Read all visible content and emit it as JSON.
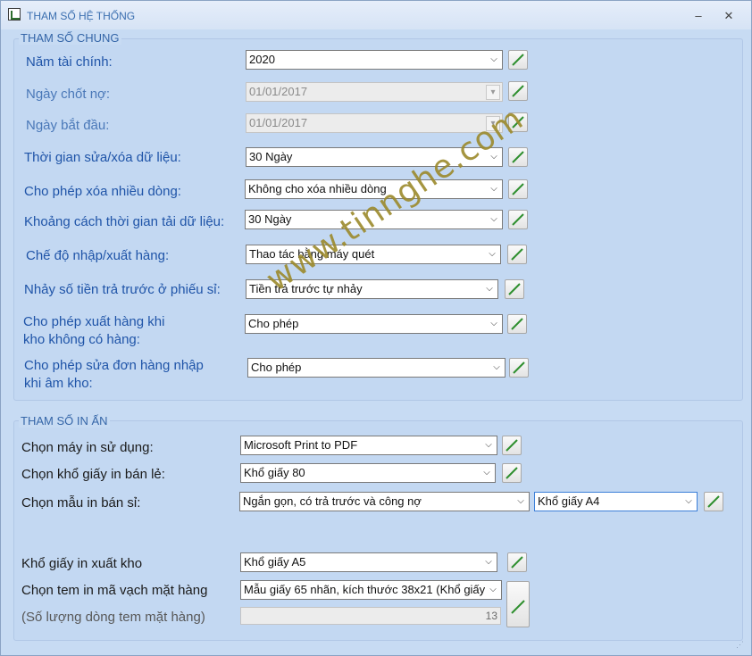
{
  "window": {
    "title": "THAM SỐ HỆ THỐNG",
    "minimize": "–",
    "close": "✕"
  },
  "general": {
    "title": "THAM SỐ CHUNG",
    "rows": [
      {
        "label": "Năm tài chính:",
        "value": "2020"
      },
      {
        "label": "Ngày chốt nợ:",
        "value": "01/01/2017"
      },
      {
        "label": "Ngày bắt đầu:",
        "value": "01/01/2017"
      },
      {
        "label": "Thời gian sửa/xóa dữ liệu:",
        "value": "30 Ngày"
      },
      {
        "label": "Cho phép xóa nhiều dòng:",
        "value": "Không cho xóa nhiều dòng"
      },
      {
        "label": "Khoảng cách thời gian tải dữ liệu:",
        "value": "30 Ngày"
      },
      {
        "label": "Chế độ nhập/xuất hàng:",
        "value": "Thao tác bằng máy quét"
      },
      {
        "label": "Nhảy số tiền trả trước ở phiếu sỉ:",
        "value": "Tiền trả trước tự nhảy"
      },
      {
        "label": "Cho phép xuất hàng khi",
        "label2": "kho không có hàng:",
        "value": "Cho phép"
      },
      {
        "label": "Cho phép sửa đơn hàng nhập",
        "label2": "khi âm kho:",
        "value": "Cho phép"
      }
    ]
  },
  "print": {
    "title": "THAM SỐ IN ẤN",
    "printer": {
      "label": "Chọn máy in sử dụng:",
      "value": "Microsoft Print to PDF"
    },
    "retail_paper": {
      "label": "Chọn khổ giấy in bán lẻ:",
      "value": "Khổ giấy 80"
    },
    "wholesale_template": {
      "label": "Chọn mẫu in bán sỉ:",
      "value": "Ngắn gọn, có trả trước và công nợ",
      "paper": "Khổ giấy A4"
    },
    "warehouse_paper": {
      "label": "Khổ giấy in xuất kho",
      "value": "Khổ giấy A5"
    },
    "barcode_template": {
      "label": "Chọn tem in mã vạch mặt hàng",
      "value": "Mẫu giấy 65 nhãn, kích thước 38x21 (Khổ giấy"
    },
    "label_rows": {
      "label": "(Số lượng dòng tem mặt hàng)",
      "value": "13"
    }
  },
  "watermark": "www.tinnghe.com",
  "colors": {
    "label_blue": "#1f54a8",
    "accent": "#3c7fd8",
    "background": "#c7dbf3"
  }
}
